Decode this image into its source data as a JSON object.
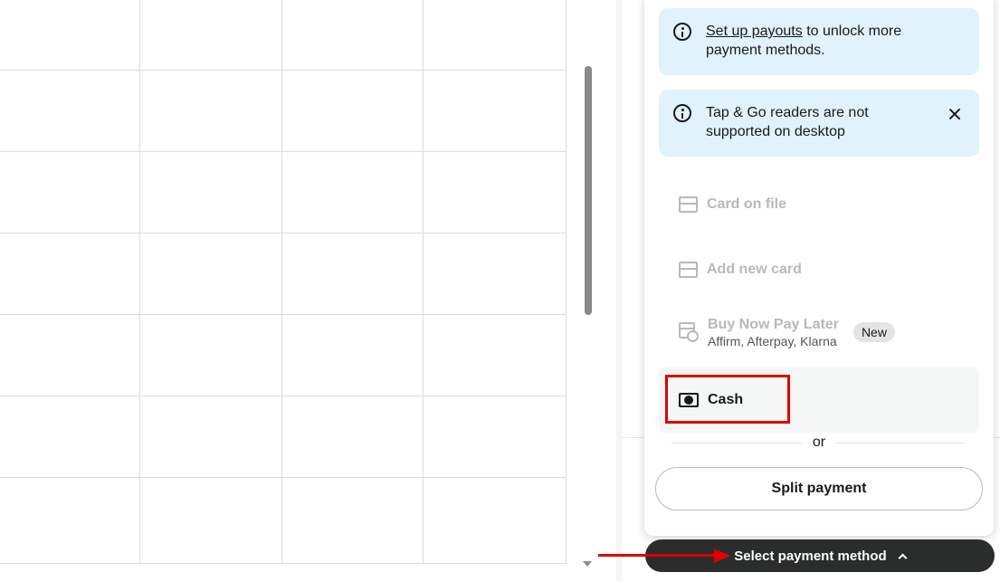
{
  "payouts_banner": {
    "link_text": "Set up payouts",
    "text": " to unlock more payment methods."
  },
  "tap_go_banner": {
    "text": "Tap & Go readers are not supported on desktop"
  },
  "payment_methods": {
    "card_on_file": "Card on file",
    "add_new_card": "Add new card",
    "bnpl": {
      "label": "Buy Now Pay Later",
      "sub": "Affirm, Afterpay, Klarna",
      "badge": "New"
    },
    "cash": "Cash"
  },
  "divider_text": "or",
  "split_payment_label": "Split payment",
  "select_payment_label": "Select payment method",
  "colors": {
    "banner_bg": "#e0f2fb",
    "disabled_text": "#b7b9bb",
    "bar_bg": "#2a2d2b",
    "annotation_red": "#e00000"
  }
}
